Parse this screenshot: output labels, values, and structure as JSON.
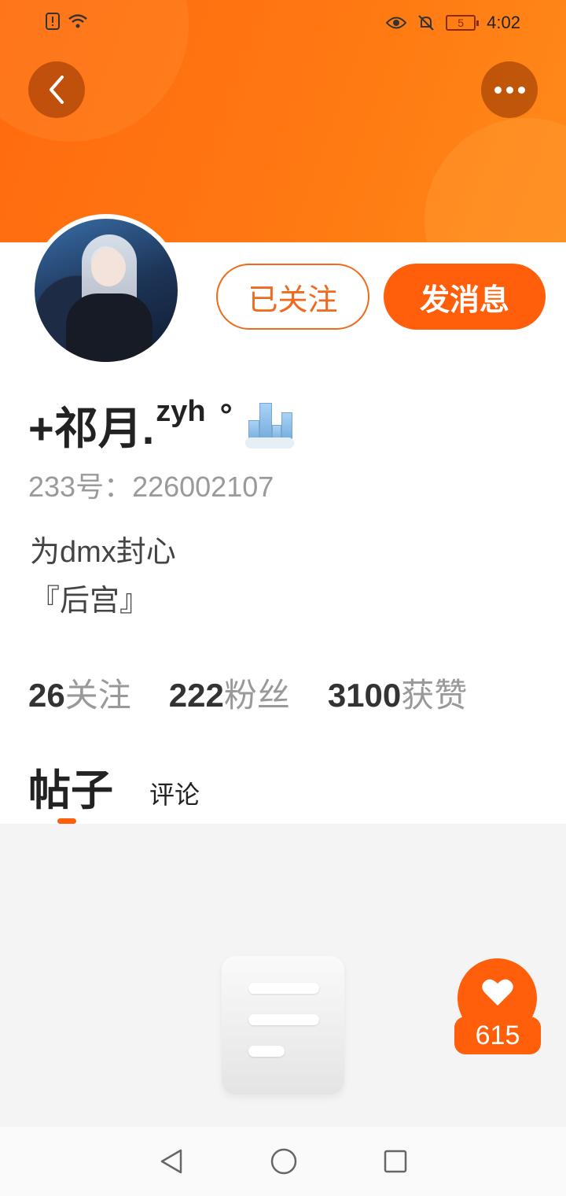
{
  "status_bar": {
    "time": "4:02",
    "battery_level": "5",
    "icons": [
      "alert-icon",
      "wifi-icon",
      "eye-icon",
      "bell-off-icon",
      "battery-icon"
    ]
  },
  "header": {
    "back_icon": "chevron-left-icon",
    "more_icon": "more-dots-icon",
    "accent_color": "#ff6a10"
  },
  "profile": {
    "username": "+祁月.",
    "username_sup": "zyh",
    "username_suffix": "°",
    "badge_icon": "city-emoji-icon",
    "uid": "233号：226002107",
    "bio_line1": "为dmx封心",
    "bio_line2": "『后宫』"
  },
  "actions": {
    "followed_label": "已关注",
    "message_label": "发消息"
  },
  "stats": [
    {
      "value": "26",
      "label": "关注"
    },
    {
      "value": "222",
      "label": "粉丝"
    },
    {
      "value": "3100",
      "label": "获赞"
    }
  ],
  "tabs": {
    "posts": "帖子",
    "comments": "评论"
  },
  "like_badge": {
    "icon": "heart-icon",
    "count": "615"
  },
  "nav": {
    "icons": [
      "back-triangle-icon",
      "home-circle-icon",
      "recents-square-icon"
    ]
  }
}
